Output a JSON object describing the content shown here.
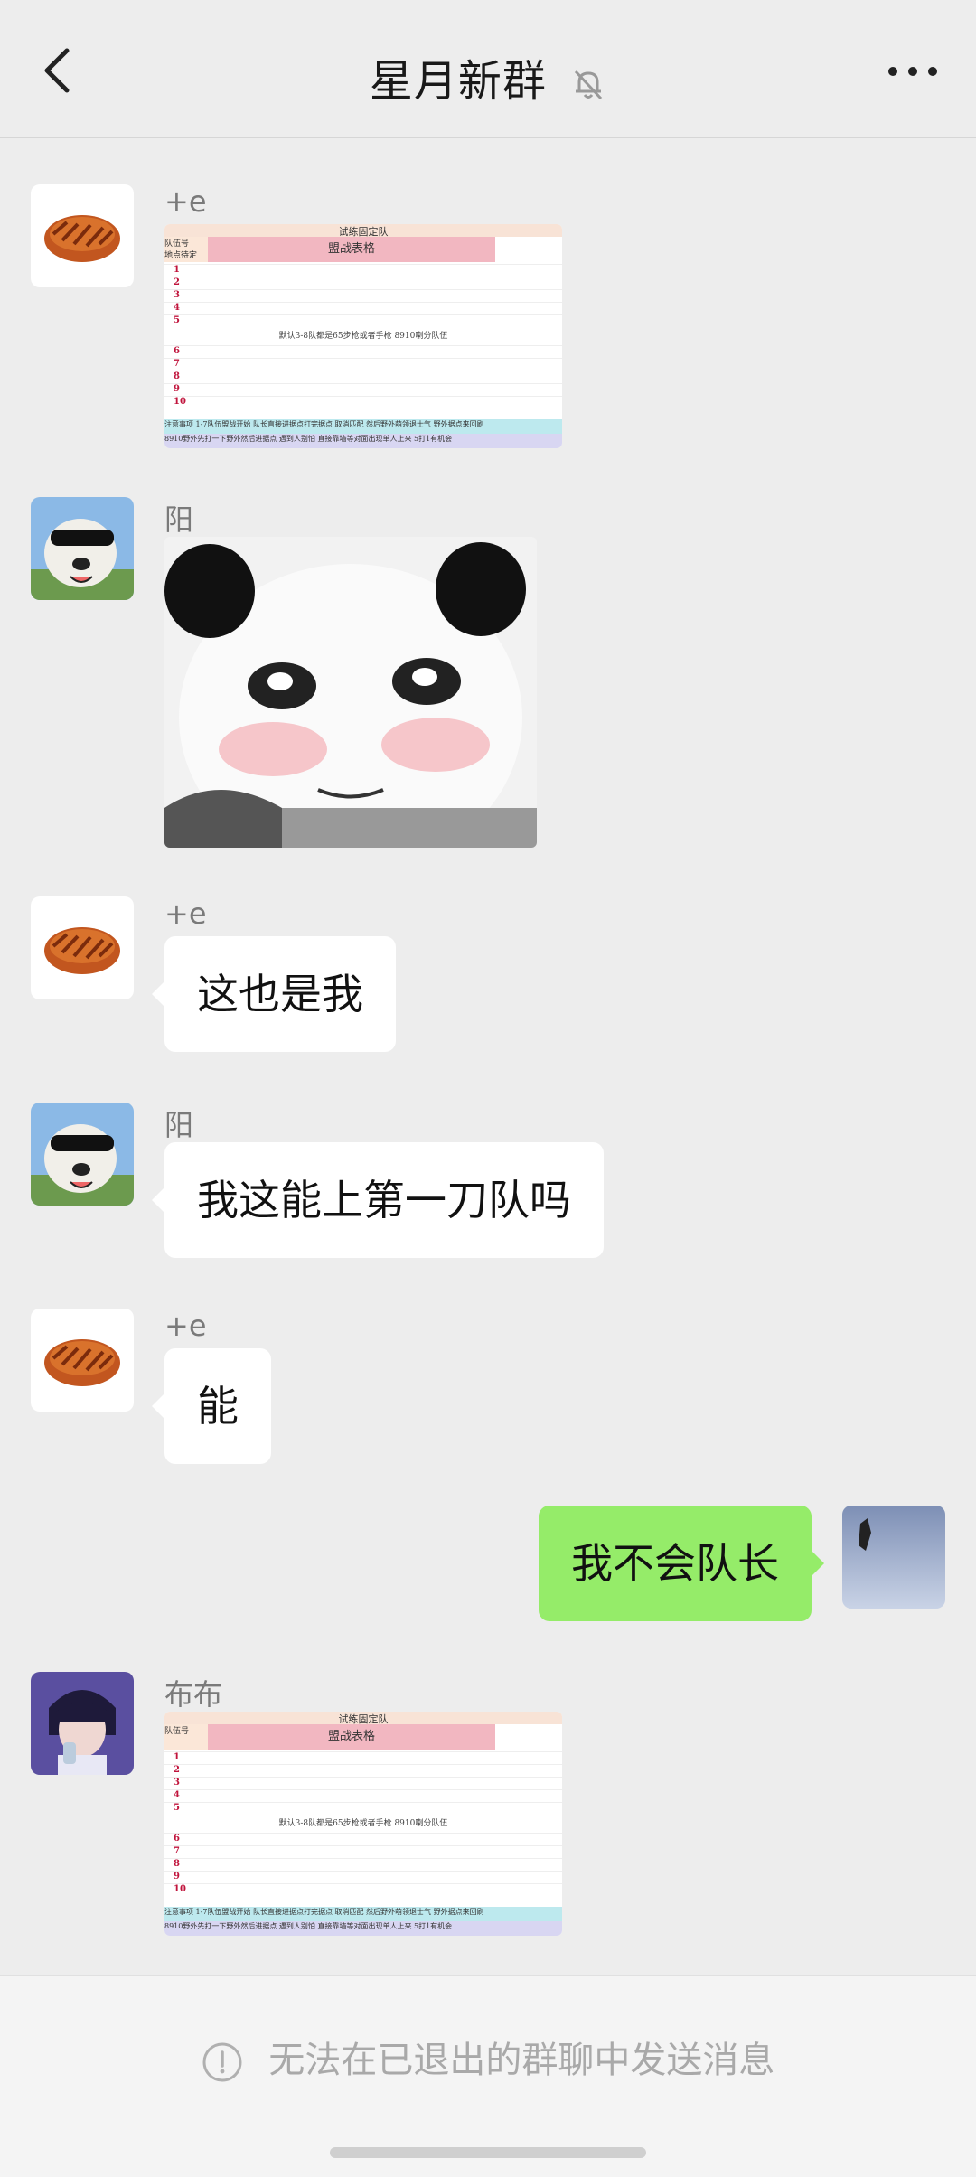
{
  "header": {
    "title": "星月新群"
  },
  "messages": [
    {
      "sender": "+e",
      "type": "image",
      "image_kind": "spreadsheet"
    },
    {
      "sender": "阳",
      "type": "image",
      "image_kind": "panda-meme"
    },
    {
      "sender": "+e",
      "type": "text",
      "text": "这也是我"
    },
    {
      "sender": "阳",
      "type": "text",
      "text": "我这能上第一刀队吗"
    },
    {
      "sender": "+e",
      "type": "text",
      "text": "能"
    },
    {
      "sender": "",
      "type": "text",
      "text": "我不会队长",
      "self": true
    },
    {
      "sender": "布布",
      "type": "image",
      "image_kind": "spreadsheet"
    }
  ],
  "sheet": {
    "title": "试练固定队",
    "subtitle": "盟战表格",
    "col_head": "队伍号",
    "col_head2": "地点待定",
    "rows_top": [
      "1",
      "2",
      "3",
      "4",
      "5"
    ],
    "band_text": "默认3-8队都是65步枪或者手枪 8910喇分队伍",
    "rows_bottom": [
      "6",
      "7",
      "8",
      "9",
      "10"
    ],
    "notes_label": "注意事项",
    "note1": "1-7队伍盟战开始 队长直接进据点打完据点 取消匹配 然后野外萌领退士气 野外据点来回刷",
    "note2": "8910野外先打一下野外然后进据点 遇到人别怕 直接靠墙等对面出现单人上来 5打1有机会"
  },
  "footer": {
    "note": "无法在已退出的群聊中发送消息"
  },
  "colors": {
    "bg": "#ededed",
    "bubble_self": "#95ec69",
    "bubble_other": "#ffffff"
  }
}
